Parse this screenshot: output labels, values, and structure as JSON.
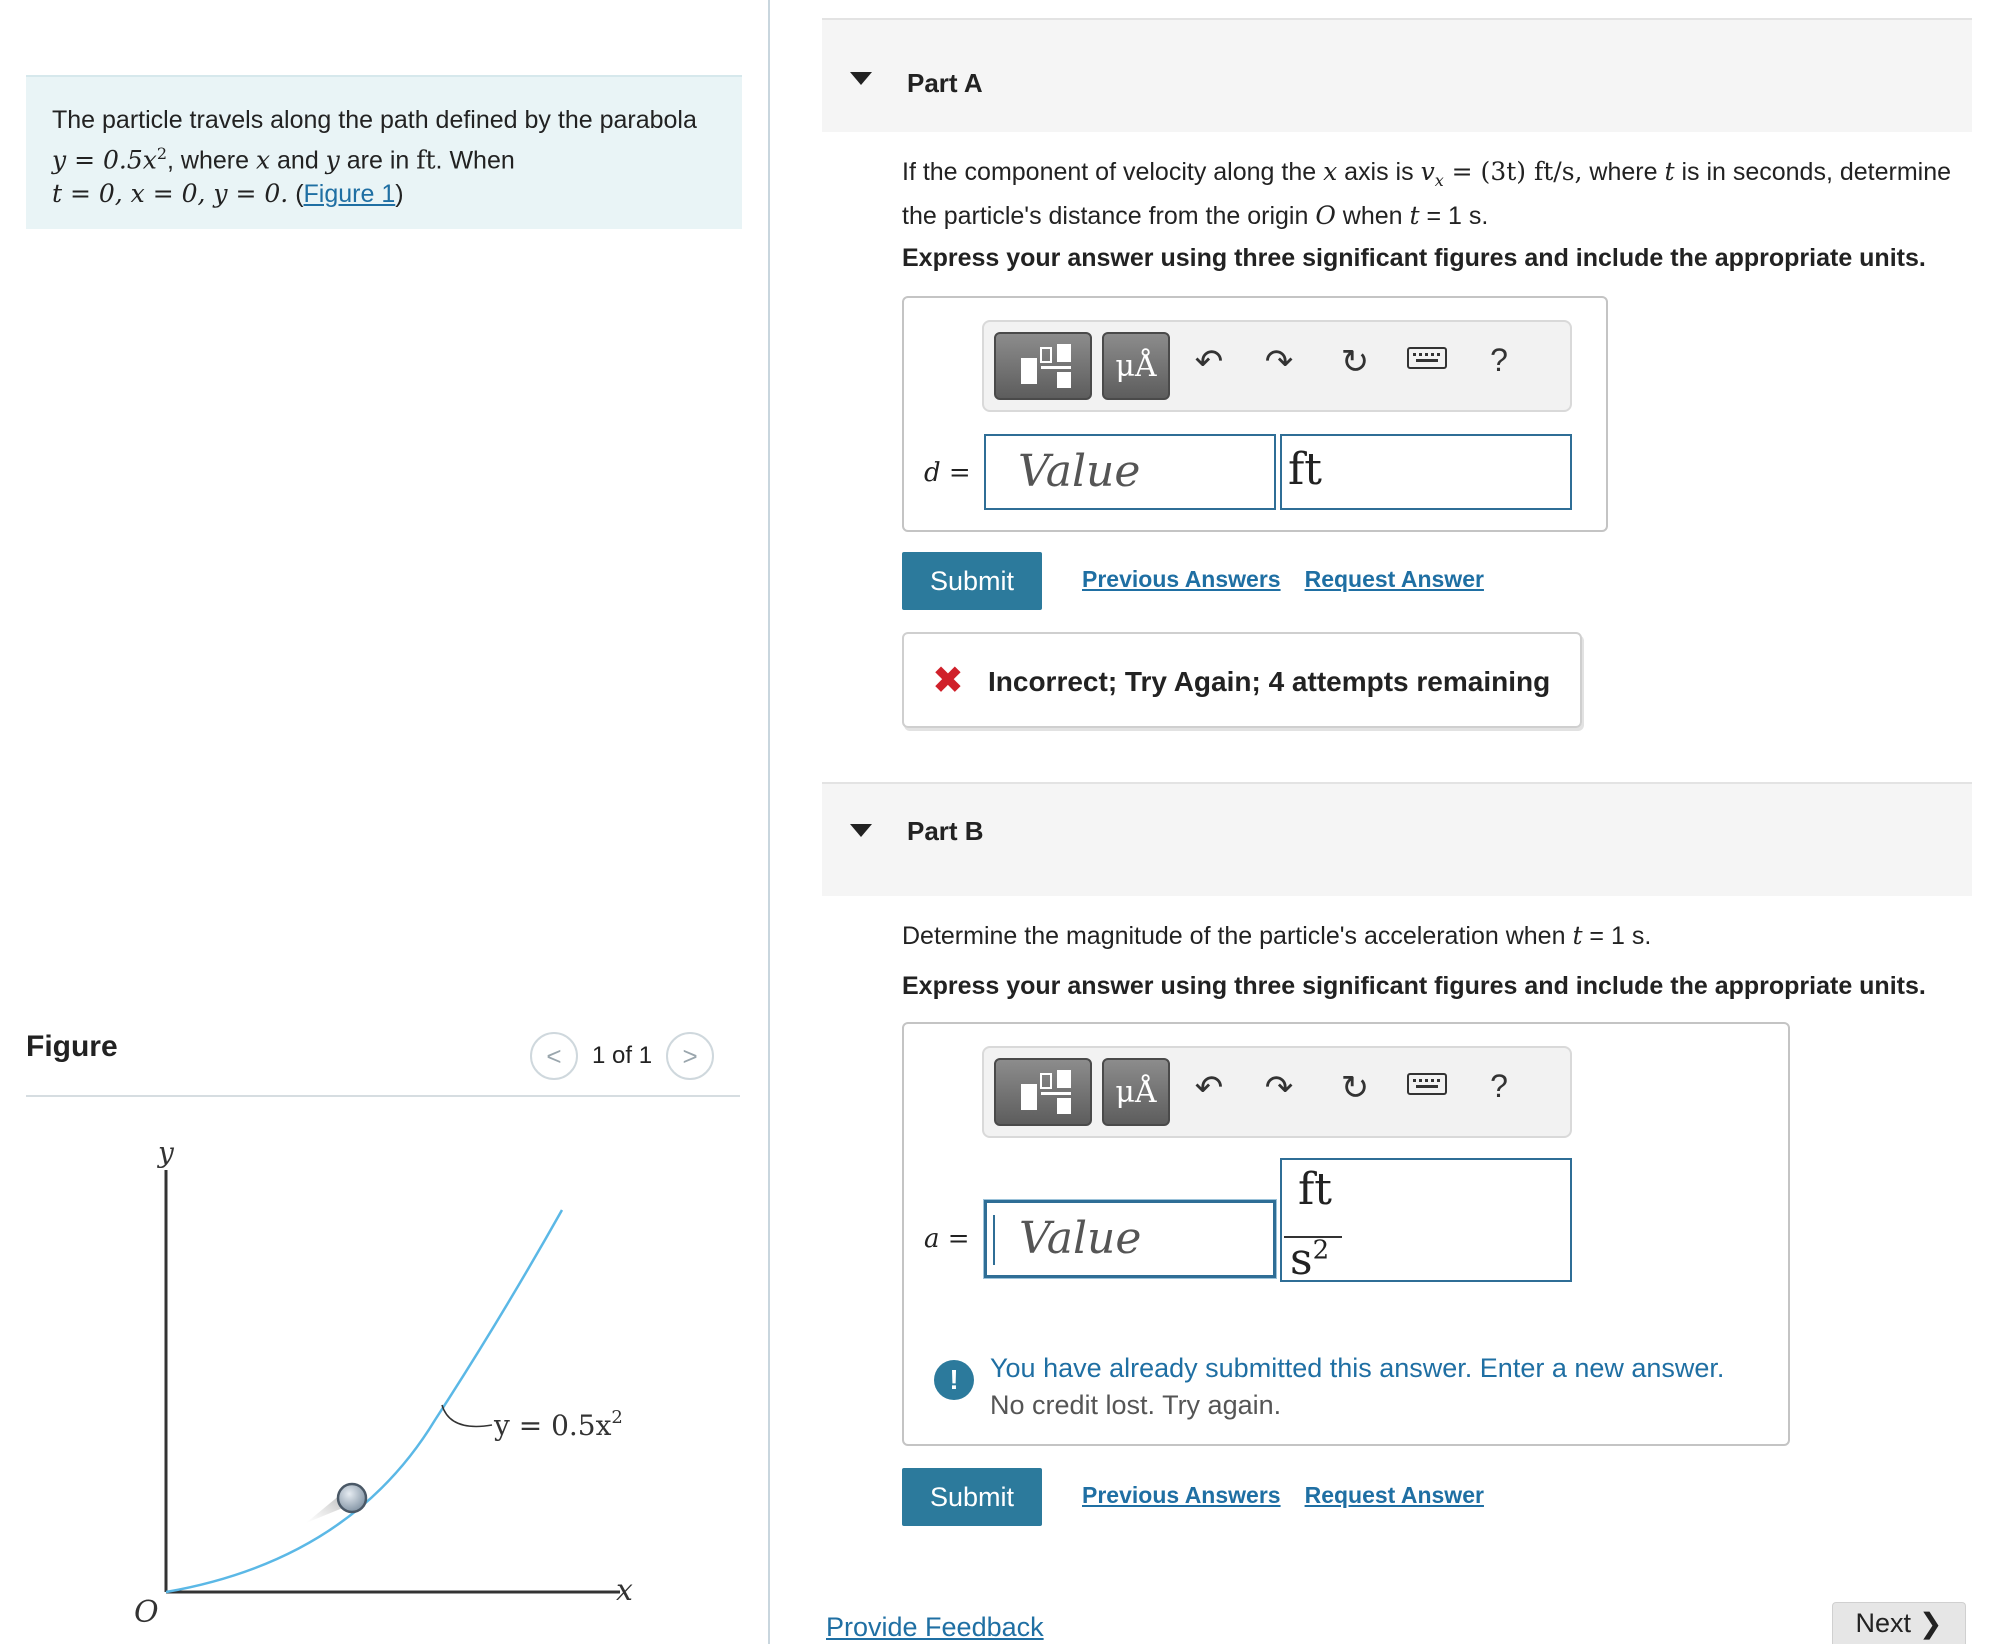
{
  "problem": {
    "text_1": "The particle travels along the path defined by the parabola ",
    "eq_path": "y = 0.5x",
    "exp2": "2",
    "text_2": ", where ",
    "var_x": "x",
    "text_and": " and ",
    "var_y": "y",
    "text_3": " are in ",
    "unit_ft": "ft",
    "text_when": ". When",
    "initial": "t = 0, x = 0, y = 0.",
    "figure_link": "Figure 1",
    "paren_open": " (",
    "paren_close": ")"
  },
  "figure": {
    "title": "Figure",
    "pager": "1 of 1",
    "prev": "<",
    "next": ">",
    "axis_y": "y",
    "axis_x": "x",
    "origin": "O",
    "curve_label": "y = 0.5x",
    "curve_exp": "2"
  },
  "partA": {
    "title": "Part A",
    "q_1": "If the component of velocity along the ",
    "q_x": "x",
    "q_2": " axis is ",
    "q_vx": "v",
    "q_sub": "x",
    "q_eq": " = (3t)  ft/s,",
    "q_3": " where ",
    "q_t": "t",
    "q_4": " is in seconds, determine the particle's distance from the origin ",
    "q_O": "O",
    "q_5": " when ",
    "q_t2": "t",
    "q_6": " = 1 s.",
    "instruction": "Express your answer using three significant figures and include the appropriate units.",
    "var": "d =",
    "value_placeholder": "Value",
    "unit": "ft",
    "submit": "Submit",
    "previous_answers": "Previous Answers",
    "request_answer": "Request Answer",
    "feedback": "Incorrect; Try Again; 4 attempts remaining"
  },
  "partB": {
    "title": "Part B",
    "q_1": "Determine the magnitude of the particle's acceleration when ",
    "q_t": "t",
    "q_2": " = 1 s.",
    "instruction": "Express your answer using three significant figures and include the appropriate units.",
    "var": "a =",
    "value_placeholder": "Value",
    "unit_num": "ft",
    "unit_den": "s",
    "unit_exp": "2",
    "warning_1": "You have already submitted this answer. Enter a new answer.",
    "warning_2": "No credit lost. Try again.",
    "submit": "Submit",
    "previous_answers": "Previous Answers",
    "request_answer": "Request Answer"
  },
  "toolbar": {
    "units_symbol": "μÅ",
    "help": "?"
  },
  "footer": {
    "provide_feedback": "Provide Feedback",
    "next": "Next"
  },
  "colors": {
    "accent": "#2c7a9c",
    "problem_bg": "#e9f4f6",
    "error": "#d0202a",
    "curve": "#5bb8e6"
  }
}
